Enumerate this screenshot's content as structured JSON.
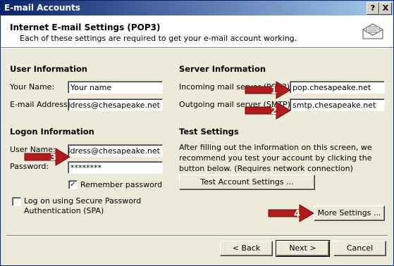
{
  "window": {
    "title": "E-mail Accounts",
    "help_button": "?",
    "close_button": "X"
  },
  "header": {
    "title": "Internet E-mail Settings (POP3)",
    "subtitle": "Each of these settings are required to get your e-mail account working."
  },
  "user_info": {
    "heading": "User Information",
    "name_label": "Your Name:",
    "name_value": "Your name",
    "email_label": "E-mail Address:",
    "email_value": "emailaddress@chesapeake.net"
  },
  "server_info": {
    "heading": "Server Information",
    "incoming_label": "Incoming mail server (POP3):",
    "incoming_value": "pop.chesapeake.net",
    "outgoing_label": "Outgoing mail server (SMTP):",
    "outgoing_value": "smtp.chesapeake.net"
  },
  "logon_info": {
    "heading": "Logon Information",
    "username_label": "User Name:",
    "username_value": "emailaddress@chesapeake.net",
    "password_label": "Password:",
    "password_value": "********",
    "remember_label": "Remember password",
    "remember_checked": true,
    "spa_label_line1": "Log on using Secure Password",
    "spa_label_line2": "Authentication (SPA)",
    "spa_checked": false
  },
  "test_settings": {
    "heading": "Test Settings",
    "description": "After filling out the information on this screen, we recommend you test your account by clicking the button below. (Requires network connection)",
    "test_button": "Test Account Settings ..."
  },
  "more_settings_button": "More Settings ...",
  "nav": {
    "back": "< Back",
    "next": "Next >",
    "cancel": "Cancel"
  },
  "annotations": [
    "1",
    "2",
    "3",
    "4"
  ],
  "colors": {
    "arrow": "#b01c1c",
    "title_bar_start": "#0a246a",
    "title_bar_end": "#a6caf0"
  }
}
